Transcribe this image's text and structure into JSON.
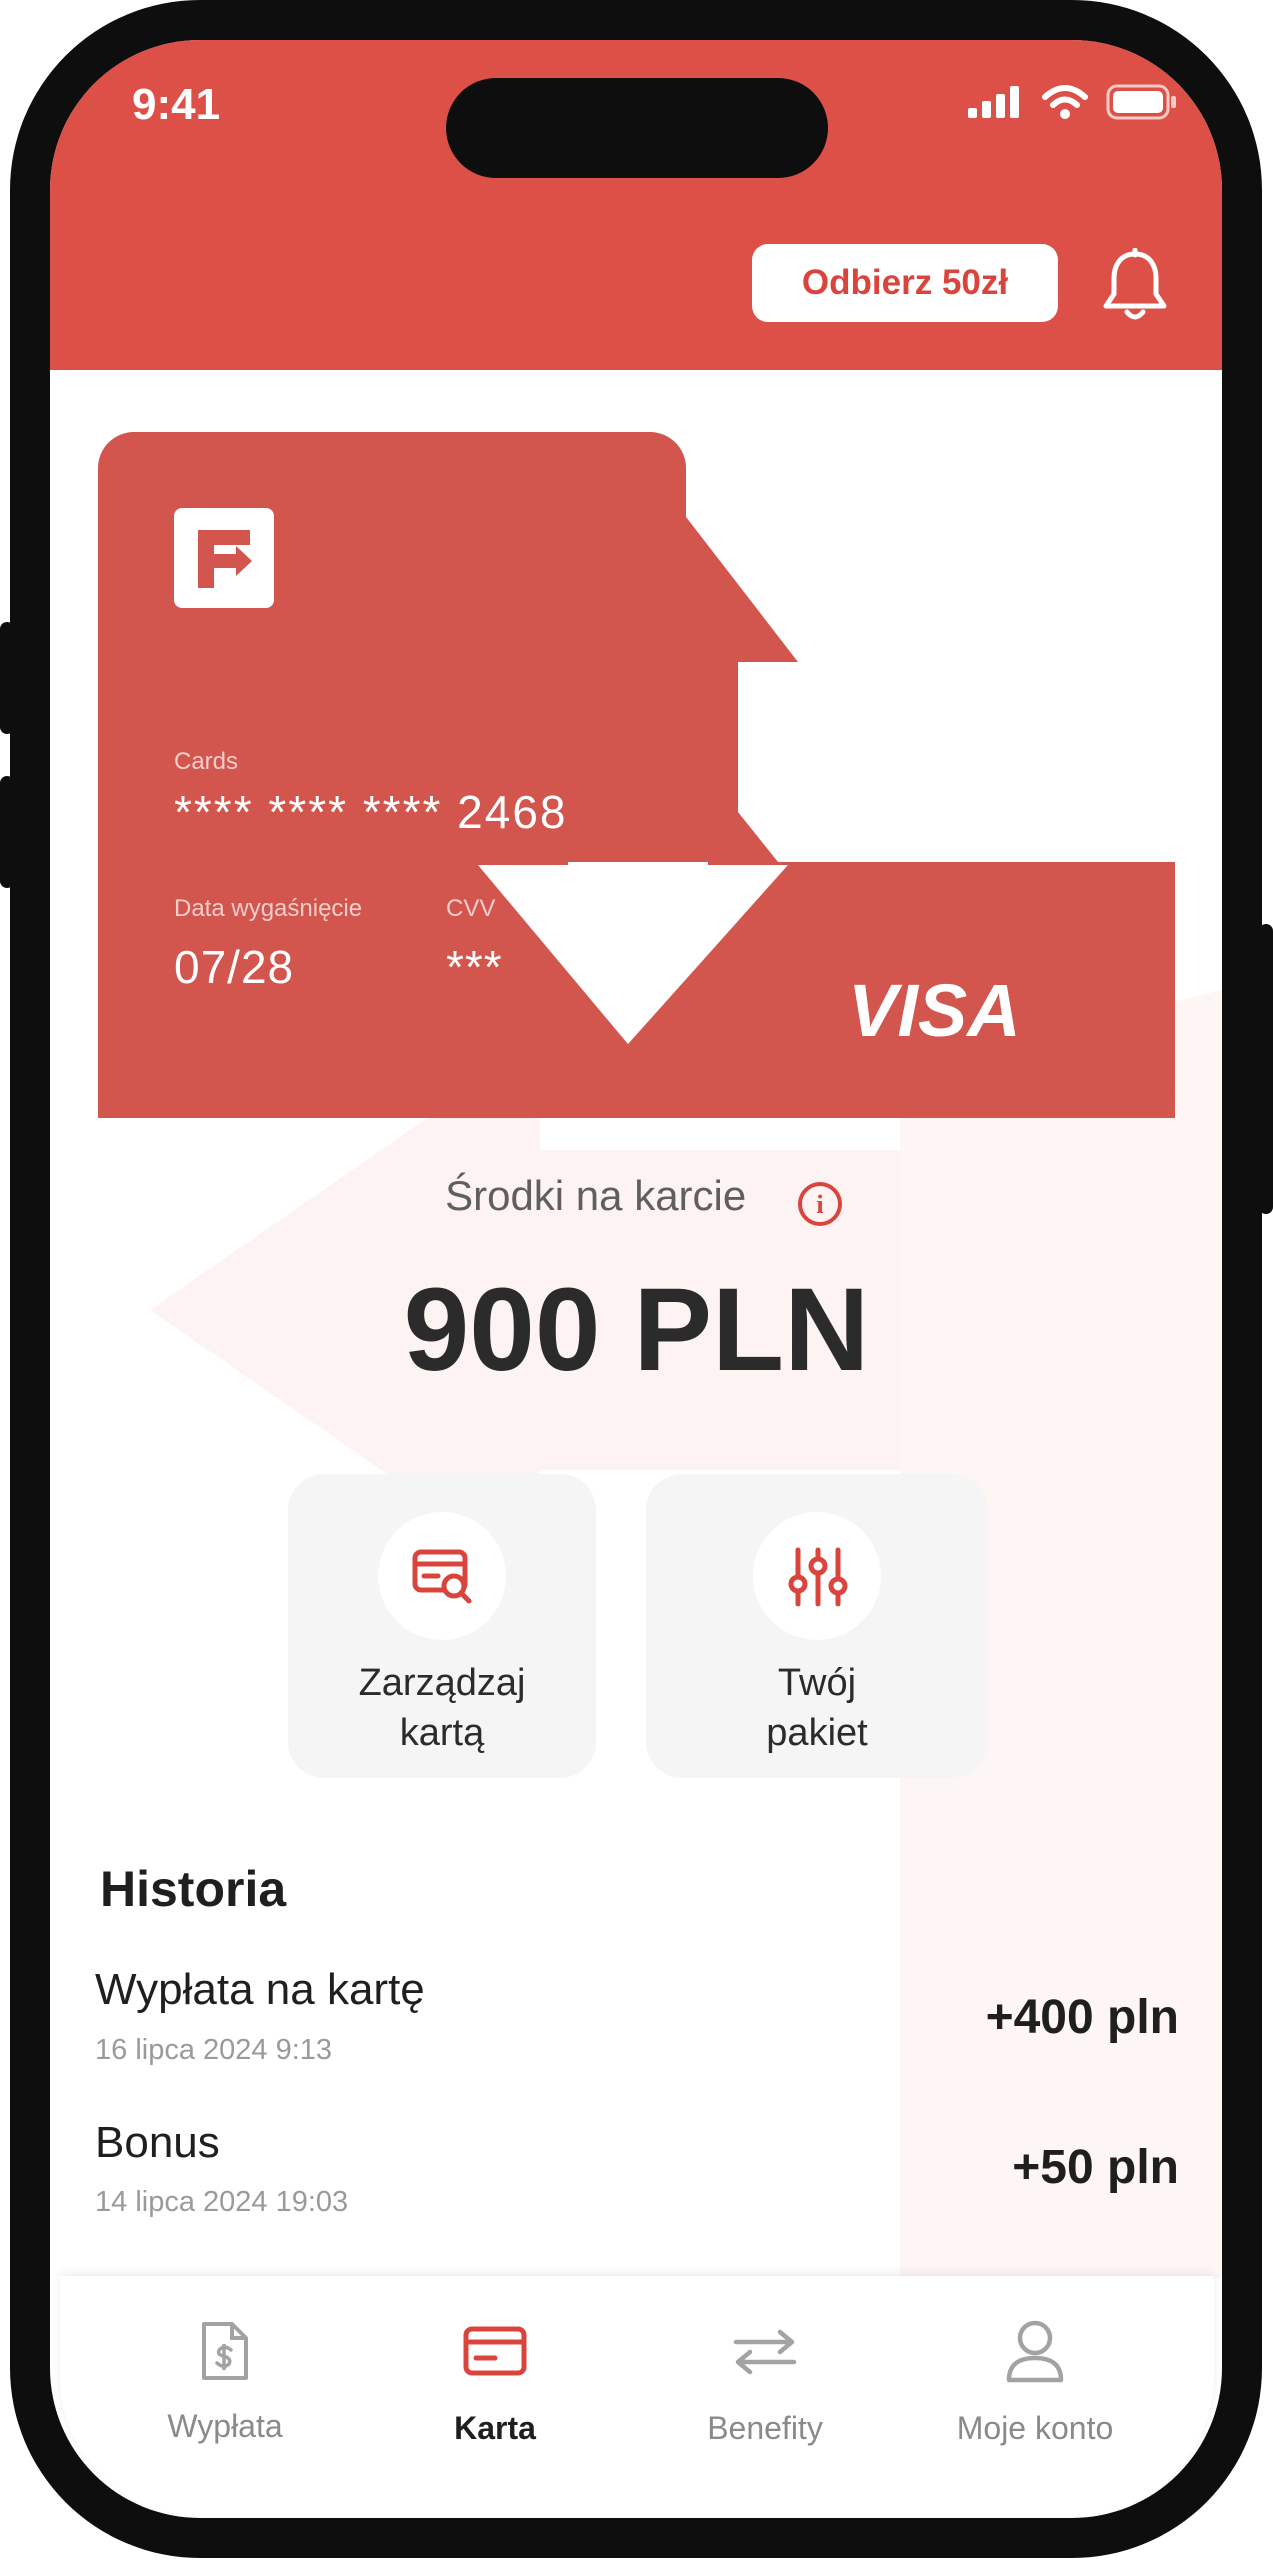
{
  "status_bar": {
    "time": "9:41"
  },
  "header": {
    "promo_prefix": "Odbierz ",
    "promo_amount": "50zł"
  },
  "card": {
    "section_label": "Cards",
    "number": "**** **** **** 2468",
    "expiry_label": "Data wygaśnięcie",
    "expiry_value": "07/28",
    "cvv_label": "CVV",
    "cvv_value": "***",
    "network": "VISA"
  },
  "balance": {
    "label": "Środki na karcie",
    "amount": "900 PLN"
  },
  "actions": [
    {
      "line1": "Zarządzaj",
      "line2": "kartą",
      "icon": "card-search-icon"
    },
    {
      "line1": "Twój",
      "line2": "pakiet",
      "icon": "sliders-icon"
    }
  ],
  "history": {
    "title": "Historia",
    "items": [
      {
        "title": "Wypłata na kartę",
        "date": "16 lipca 2024 9:13",
        "amount": "+400 pln"
      },
      {
        "title": "Bonus",
        "date": "14 lipca 2024 19:03",
        "amount": "+50 pln"
      }
    ]
  },
  "tabs": [
    {
      "label": "Wypłata",
      "icon": "document-dollar-icon",
      "active": false
    },
    {
      "label": "Karta",
      "icon": "card-icon",
      "active": true
    },
    {
      "label": "Benefity",
      "icon": "transfer-arrows-icon",
      "active": false
    },
    {
      "label": "Moje konto",
      "icon": "user-icon",
      "active": false
    }
  ],
  "colors": {
    "brand": "#dc5048",
    "accent_red": "#d9443c",
    "text_dark": "#1f1f1f",
    "text_muted": "#9a9a9a"
  }
}
